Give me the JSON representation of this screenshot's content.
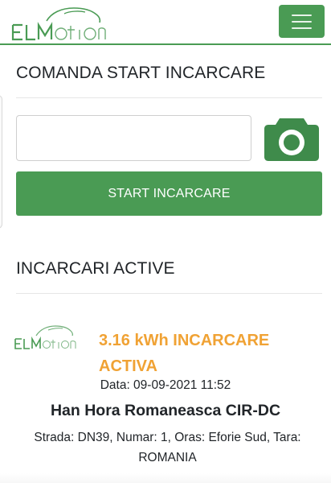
{
  "navbar": {
    "logo_text": "ELMotion",
    "menu_icon": "hamburger-icon",
    "accent_color": "#4a9b54"
  },
  "start_section": {
    "title": "COMANDA START INCARCARE",
    "code_input": {
      "value": "",
      "placeholder": ""
    },
    "camera_icon": "camera-icon",
    "start_button_label": "START INCARCARE"
  },
  "active_section": {
    "title": "INCARCARI ACTIVE",
    "sessions": [
      {
        "logo_text": "ELMotion",
        "status": "3.16 kWh INCARCARE ACTIVA",
        "date": "Data: 09-09-2021 11:52",
        "station": "Han Hora Romaneasca CIR-DC",
        "address": "Strada: DN39, Numar: 1, Oras: Eforie Sud, Tara: ROMANIA",
        "status_color": "#f0a234"
      }
    ]
  }
}
